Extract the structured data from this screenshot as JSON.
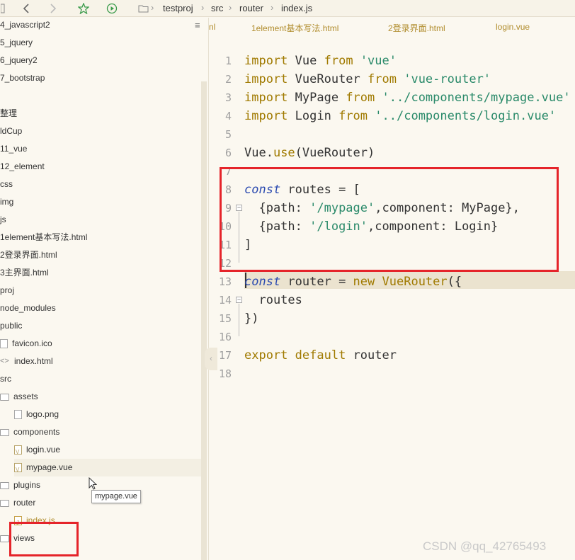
{
  "toolbar": {
    "breadcrumb": [
      "testproj",
      "src",
      "router",
      "index.js"
    ]
  },
  "sidebar": {
    "items": [
      {
        "label": "4_javascript2",
        "kind": "none"
      },
      {
        "label": "5_jquery",
        "kind": "none"
      },
      {
        "label": "6_jquery2",
        "kind": "none"
      },
      {
        "label": "7_bootstrap",
        "kind": "none"
      },
      {
        "label": "",
        "kind": "none"
      },
      {
        "label": "整理",
        "kind": "none"
      },
      {
        "label": "ldCup",
        "kind": "none"
      },
      {
        "label": "11_vue",
        "kind": "none"
      },
      {
        "label": "12_element",
        "kind": "none"
      },
      {
        "label": "css",
        "kind": "none"
      },
      {
        "label": "img",
        "kind": "none"
      },
      {
        "label": "js",
        "kind": "none"
      },
      {
        "label": "1element基本写法.html",
        "kind": "none"
      },
      {
        "label": "2登录界面.html",
        "kind": "none"
      },
      {
        "label": "3主界面.html",
        "kind": "none"
      },
      {
        "label": "proj",
        "kind": "none"
      },
      {
        "label": "node_modules",
        "kind": "none"
      },
      {
        "label": "public",
        "kind": "none"
      },
      {
        "label": "favicon.ico",
        "kind": "img"
      },
      {
        "label": "index.html",
        "kind": "code"
      },
      {
        "label": "src",
        "kind": "none"
      },
      {
        "label": "assets",
        "kind": "folder"
      },
      {
        "label": "logo.png",
        "kind": "img"
      },
      {
        "label": "components",
        "kind": "folder"
      },
      {
        "label": "login.vue",
        "kind": "vue"
      },
      {
        "label": "mypage.vue",
        "kind": "vue"
      },
      {
        "label": "plugins",
        "kind": "folder"
      },
      {
        "label": "router",
        "kind": "folder"
      },
      {
        "label": "index.js",
        "kind": "js"
      },
      {
        "label": "views",
        "kind": "folder"
      }
    ]
  },
  "tooltip": "mypage.vue",
  "tabs": [
    "nl",
    "1element基本写法.html",
    "2登录界面.html",
    "login.vue"
  ],
  "editor": {
    "lines": [
      {
        "n": "1",
        "tokens": [
          [
            "kw",
            "import"
          ],
          [
            "p",
            " Vue "
          ],
          [
            "kw",
            "from"
          ],
          [
            "p",
            " "
          ],
          [
            "str",
            "'vue'"
          ]
        ]
      },
      {
        "n": "2",
        "tokens": [
          [
            "kw",
            "import"
          ],
          [
            "p",
            " VueRouter "
          ],
          [
            "kw",
            "from"
          ],
          [
            "p",
            " "
          ],
          [
            "str",
            "'vue-router'"
          ]
        ]
      },
      {
        "n": "3",
        "tokens": [
          [
            "kw",
            "import"
          ],
          [
            "p",
            " MyPage "
          ],
          [
            "kw",
            "from"
          ],
          [
            "p",
            " "
          ],
          [
            "str",
            "'../components/mypage.vue'"
          ]
        ]
      },
      {
        "n": "4",
        "tokens": [
          [
            "kw",
            "import"
          ],
          [
            "p",
            " Login "
          ],
          [
            "kw",
            "from"
          ],
          [
            "p",
            " "
          ],
          [
            "str",
            "'../components/login.vue'"
          ]
        ]
      },
      {
        "n": "5",
        "tokens": []
      },
      {
        "n": "6",
        "tokens": [
          [
            "p",
            "Vue."
          ],
          [
            "fn",
            "use"
          ],
          [
            "p",
            "(VueRouter)"
          ]
        ]
      },
      {
        "n": "7",
        "tokens": []
      },
      {
        "n": "8",
        "tokens": [
          [
            "kwi",
            "const"
          ],
          [
            "p",
            " routes = ["
          ]
        ]
      },
      {
        "n": "9",
        "tokens": [
          [
            "p",
            "  {path: "
          ],
          [
            "str",
            "'/mypage'"
          ],
          [
            "p",
            ",component: MyPage},"
          ]
        ]
      },
      {
        "n": "10",
        "tokens": [
          [
            "p",
            "  {path: "
          ],
          [
            "str",
            "'/login'"
          ],
          [
            "p",
            ",component: Login}"
          ]
        ]
      },
      {
        "n": "11",
        "tokens": [
          [
            "p",
            "]"
          ]
        ]
      },
      {
        "n": "12",
        "tokens": []
      },
      {
        "n": "13",
        "tokens": [
          [
            "kwi",
            "const"
          ],
          [
            "p",
            " router = "
          ],
          [
            "kw",
            "new"
          ],
          [
            "p",
            " "
          ],
          [
            "fn",
            "VueRouter"
          ],
          [
            "p",
            "({"
          ]
        ]
      },
      {
        "n": "14",
        "tokens": [
          [
            "p",
            "  routes"
          ]
        ]
      },
      {
        "n": "15",
        "tokens": [
          [
            "p",
            "})"
          ]
        ]
      },
      {
        "n": "16",
        "tokens": []
      },
      {
        "n": "17",
        "tokens": [
          [
            "kw",
            "export"
          ],
          [
            "p",
            " "
          ],
          [
            "kw",
            "default"
          ],
          [
            "p",
            " router"
          ]
        ]
      },
      {
        "n": "18",
        "tokens": []
      }
    ]
  },
  "watermark": "CSDN @qq_42765493",
  "colors": {
    "annotation": "#e5242a",
    "keyword": "#a07a00",
    "string": "#2a8a6a",
    "const": "#2c4bb0"
  }
}
